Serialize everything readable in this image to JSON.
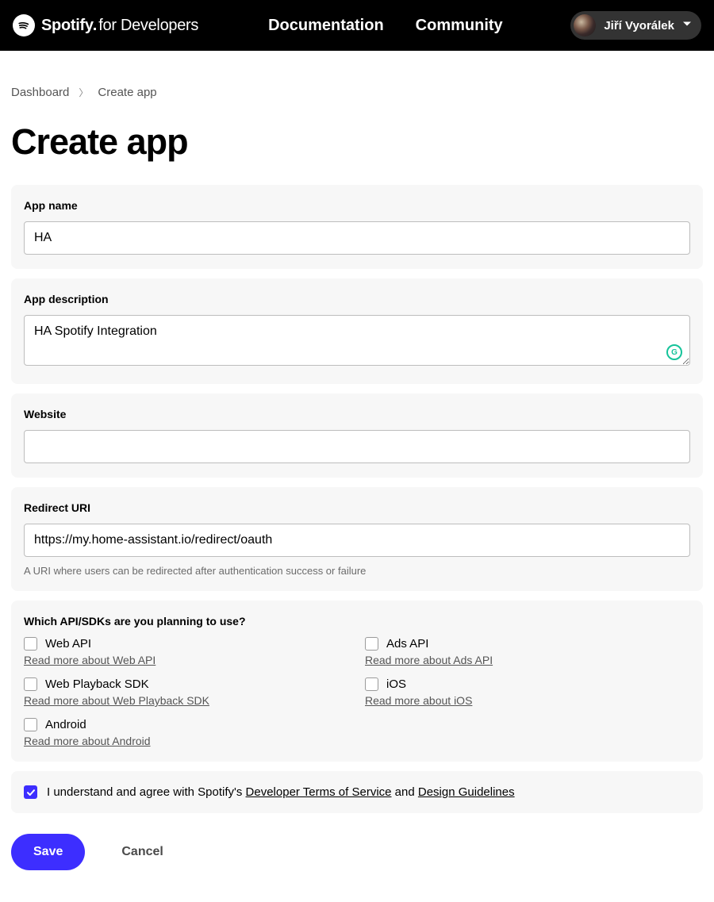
{
  "header": {
    "brand_main": "Spotify",
    "brand_sub": "for Developers",
    "nav": {
      "documentation": "Documentation",
      "community": "Community"
    },
    "user_name": "Jiří Vyorálek"
  },
  "breadcrumb": {
    "root": "Dashboard",
    "current": "Create app"
  },
  "page_title": "Create app",
  "form": {
    "app_name": {
      "label": "App name",
      "value": "HA"
    },
    "app_description": {
      "label": "App description",
      "value": "HA Spotify Integration"
    },
    "website": {
      "label": "Website",
      "value": ""
    },
    "redirect_uri": {
      "label": "Redirect URI",
      "value": "https://my.home-assistant.io/redirect/oauth",
      "hint": "A URI where users can be redirected after authentication success or failure"
    },
    "apis": {
      "label": "Which API/SDKs are you planning to use?",
      "items": [
        {
          "name": "Web API",
          "link": "Read more about Web API",
          "checked": false
        },
        {
          "name": "Ads API",
          "link": "Read more about Ads API",
          "checked": false
        },
        {
          "name": "Web Playback SDK",
          "link": "Read more about Web Playback SDK",
          "checked": false
        },
        {
          "name": "iOS",
          "link": "Read more about iOS",
          "checked": false
        },
        {
          "name": "Android",
          "link": "Read more about Android",
          "checked": false
        }
      ]
    },
    "agree": {
      "checked": true,
      "prefix": "I understand and agree with Spotify's ",
      "link1": "Developer Terms of Service",
      "mid": " and ",
      "link2": "Design Guidelines"
    },
    "buttons": {
      "save": "Save",
      "cancel": "Cancel"
    }
  }
}
